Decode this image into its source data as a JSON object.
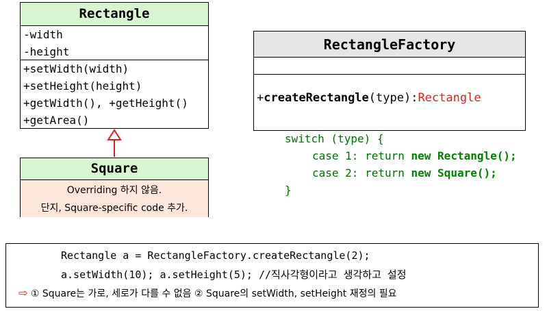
{
  "rectangle": {
    "name": "Rectangle",
    "attributes": [
      "-width",
      "-height"
    ],
    "operations": [
      "+setWidth(width)",
      "+setHeight(height)",
      "+getWidth(), +getHeight()",
      "+getArea()"
    ]
  },
  "square": {
    "name": "Square",
    "note_line1": "Overriding 하지 않음.",
    "note_line2": "단지, Square-specific code 추가."
  },
  "factory": {
    "name": "RectangleFactory",
    "op_prefix": "+",
    "op_name": "createRectangle",
    "op_params": "(type):",
    "op_return": "Rectangle"
  },
  "code": {
    "line1": "switch (type) {",
    "line2_pre": "case 1: return ",
    "line2_kw": "new",
    "line2_post": "Rectangle();",
    "line3_pre": "case 2: return ",
    "line3_kw": "new",
    "line3_post": "Square();",
    "line4": "}"
  },
  "note": {
    "line1": "Rectangle a = RectangleFactory.createRectangle(2);",
    "line2": "a.setWidth(10);  a.setHeight(5); //직사각형이라고 생각하고 설정",
    "hint_symbol": "⇨",
    "line3": "① Square는 가로, 세로가 다를 수 없음 ② Square의 setWidth, setHeight 재정의 필요"
  },
  "colors": {
    "class_header": "#d8f5d2",
    "square_body": "#fde6da",
    "factory_header": "#e6e6e6",
    "arrow": "#e02020",
    "code": "#008000"
  }
}
